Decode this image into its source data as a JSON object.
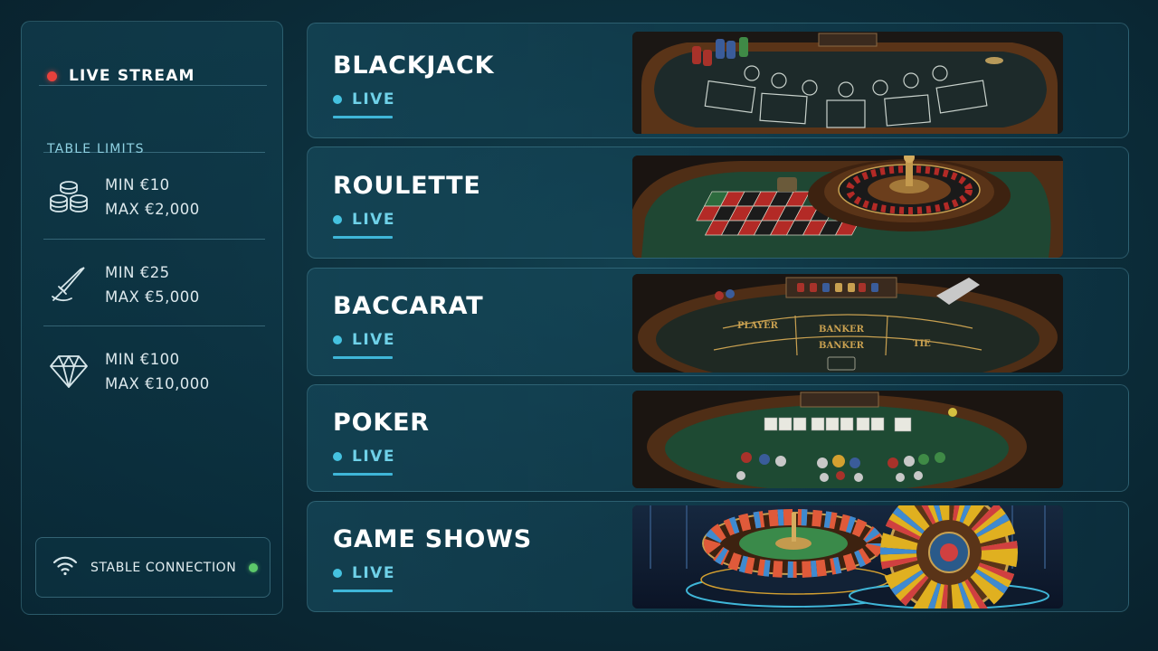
{
  "sidebar": {
    "live_stream": "LIVE STREAM",
    "table_limits_title": "TABLE LIMITS",
    "limits": [
      {
        "icon": "chips-stack-icon",
        "min": "MIN €10",
        "max": "MAX €2,000"
      },
      {
        "icon": "sword-icon",
        "min": "MIN €25",
        "max": "MAX €5,000"
      },
      {
        "icon": "diamond-icon",
        "min": "MIN €100",
        "max": "MAX €10,000"
      }
    ],
    "connection": {
      "icon": "wifi-icon",
      "label": "STABLE CONNECTION"
    }
  },
  "games": [
    {
      "name": "BLACKJACK",
      "status": "LIVE"
    },
    {
      "name": "ROULETTE",
      "status": "LIVE"
    },
    {
      "name": "BACCARAT",
      "status": "LIVE",
      "table_labels": [
        "PLAYER",
        "BANKER",
        "BANKER",
        "TIE"
      ]
    },
    {
      "name": "POKER",
      "status": "LIVE"
    },
    {
      "name": "GAME SHOWS",
      "status": "LIVE"
    }
  ],
  "colors": {
    "live_dot": "#e8413c",
    "status_dot": "#45c2e0",
    "connection_dot": "#5cc86a",
    "felt_green": "#1e4a33",
    "wood": "#5a3418"
  }
}
